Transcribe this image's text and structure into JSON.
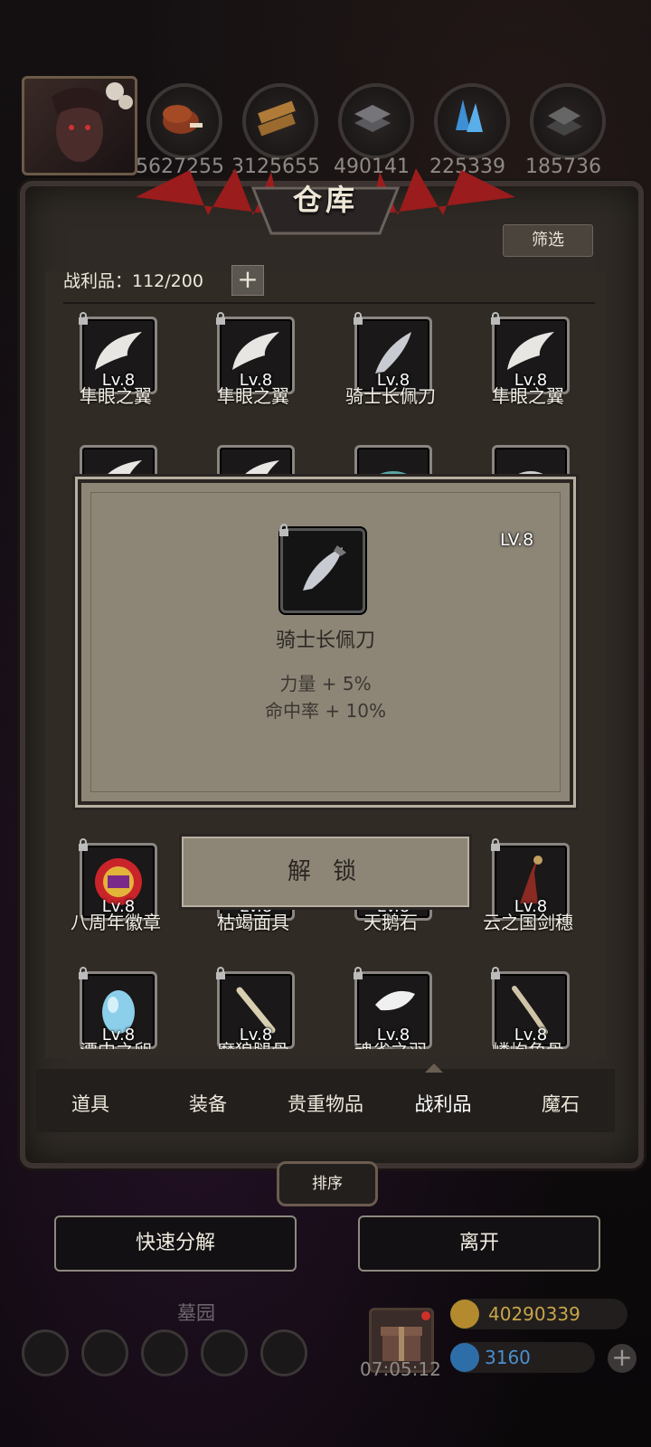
{
  "resources": [
    {
      "icon": "meat-icon",
      "value": "5627255"
    },
    {
      "icon": "wood-icon",
      "value": "3125655"
    },
    {
      "icon": "iron-icon",
      "value": "490141"
    },
    {
      "icon": "crystal-icon",
      "value": "225339"
    },
    {
      "icon": "ore-icon",
      "value": "185736"
    }
  ],
  "panel": {
    "title": "仓库",
    "filter": "筛选",
    "loot_label": "战利品：112/200",
    "add": "+"
  },
  "items_row1": [
    {
      "name": "隼眼之翼",
      "lv": "Lv.8",
      "icon": "wing-icon"
    },
    {
      "name": "隼眼之翼",
      "lv": "Lv.8",
      "icon": "wing-icon"
    },
    {
      "name": "骑士长佩刀",
      "lv": "Lv.8",
      "icon": "knife-icon"
    },
    {
      "name": "隼眼之翼",
      "lv": "Lv.8",
      "icon": "wing-icon"
    }
  ],
  "items_row3": [
    {
      "name": "八周年徽章",
      "lv": "Lv.8",
      "icon": "badge-icon"
    },
    {
      "name": "枯竭面具",
      "lv": "Lv.8",
      "icon": "mask-icon"
    },
    {
      "name": "天鹅石",
      "lv": "Lv.8",
      "icon": "stone-icon"
    },
    {
      "name": "云之国剑穗",
      "lv": "Lv.8",
      "icon": "tassel-icon"
    }
  ],
  "items_row4": [
    {
      "name": "潭中之卵",
      "lv": "Lv.8",
      "icon": "egg-icon"
    },
    {
      "name": "魔狼腿骨",
      "lv": "Lv.8",
      "icon": "bone-icon"
    },
    {
      "name": "魂雀之羽",
      "lv": "Lv.8",
      "icon": "feather-icon"
    },
    {
      "name": "嶙峋角骨",
      "lv": "Lv.8",
      "icon": "horn-icon"
    }
  ],
  "popup": {
    "lv": "LV.8",
    "name": "骑士长佩刀",
    "stats": [
      "力量 + 5%",
      "命中率 + 10%"
    ],
    "unlock": "解 锁"
  },
  "tabs": [
    "道具",
    "装备",
    "贵重物品",
    "战利品",
    "魔石"
  ],
  "active_tab": "战利品",
  "sort": "排序",
  "quick_decompose": "快速分解",
  "leave": "离开",
  "location": "墓园",
  "timer": "07:05:12",
  "gold": "40290339",
  "gems": "3160",
  "colors": {
    "gold_text": "#c8a54a",
    "gem_text": "#4a8fd0",
    "panel": "#2f2a25",
    "popup": "#8d8677"
  }
}
